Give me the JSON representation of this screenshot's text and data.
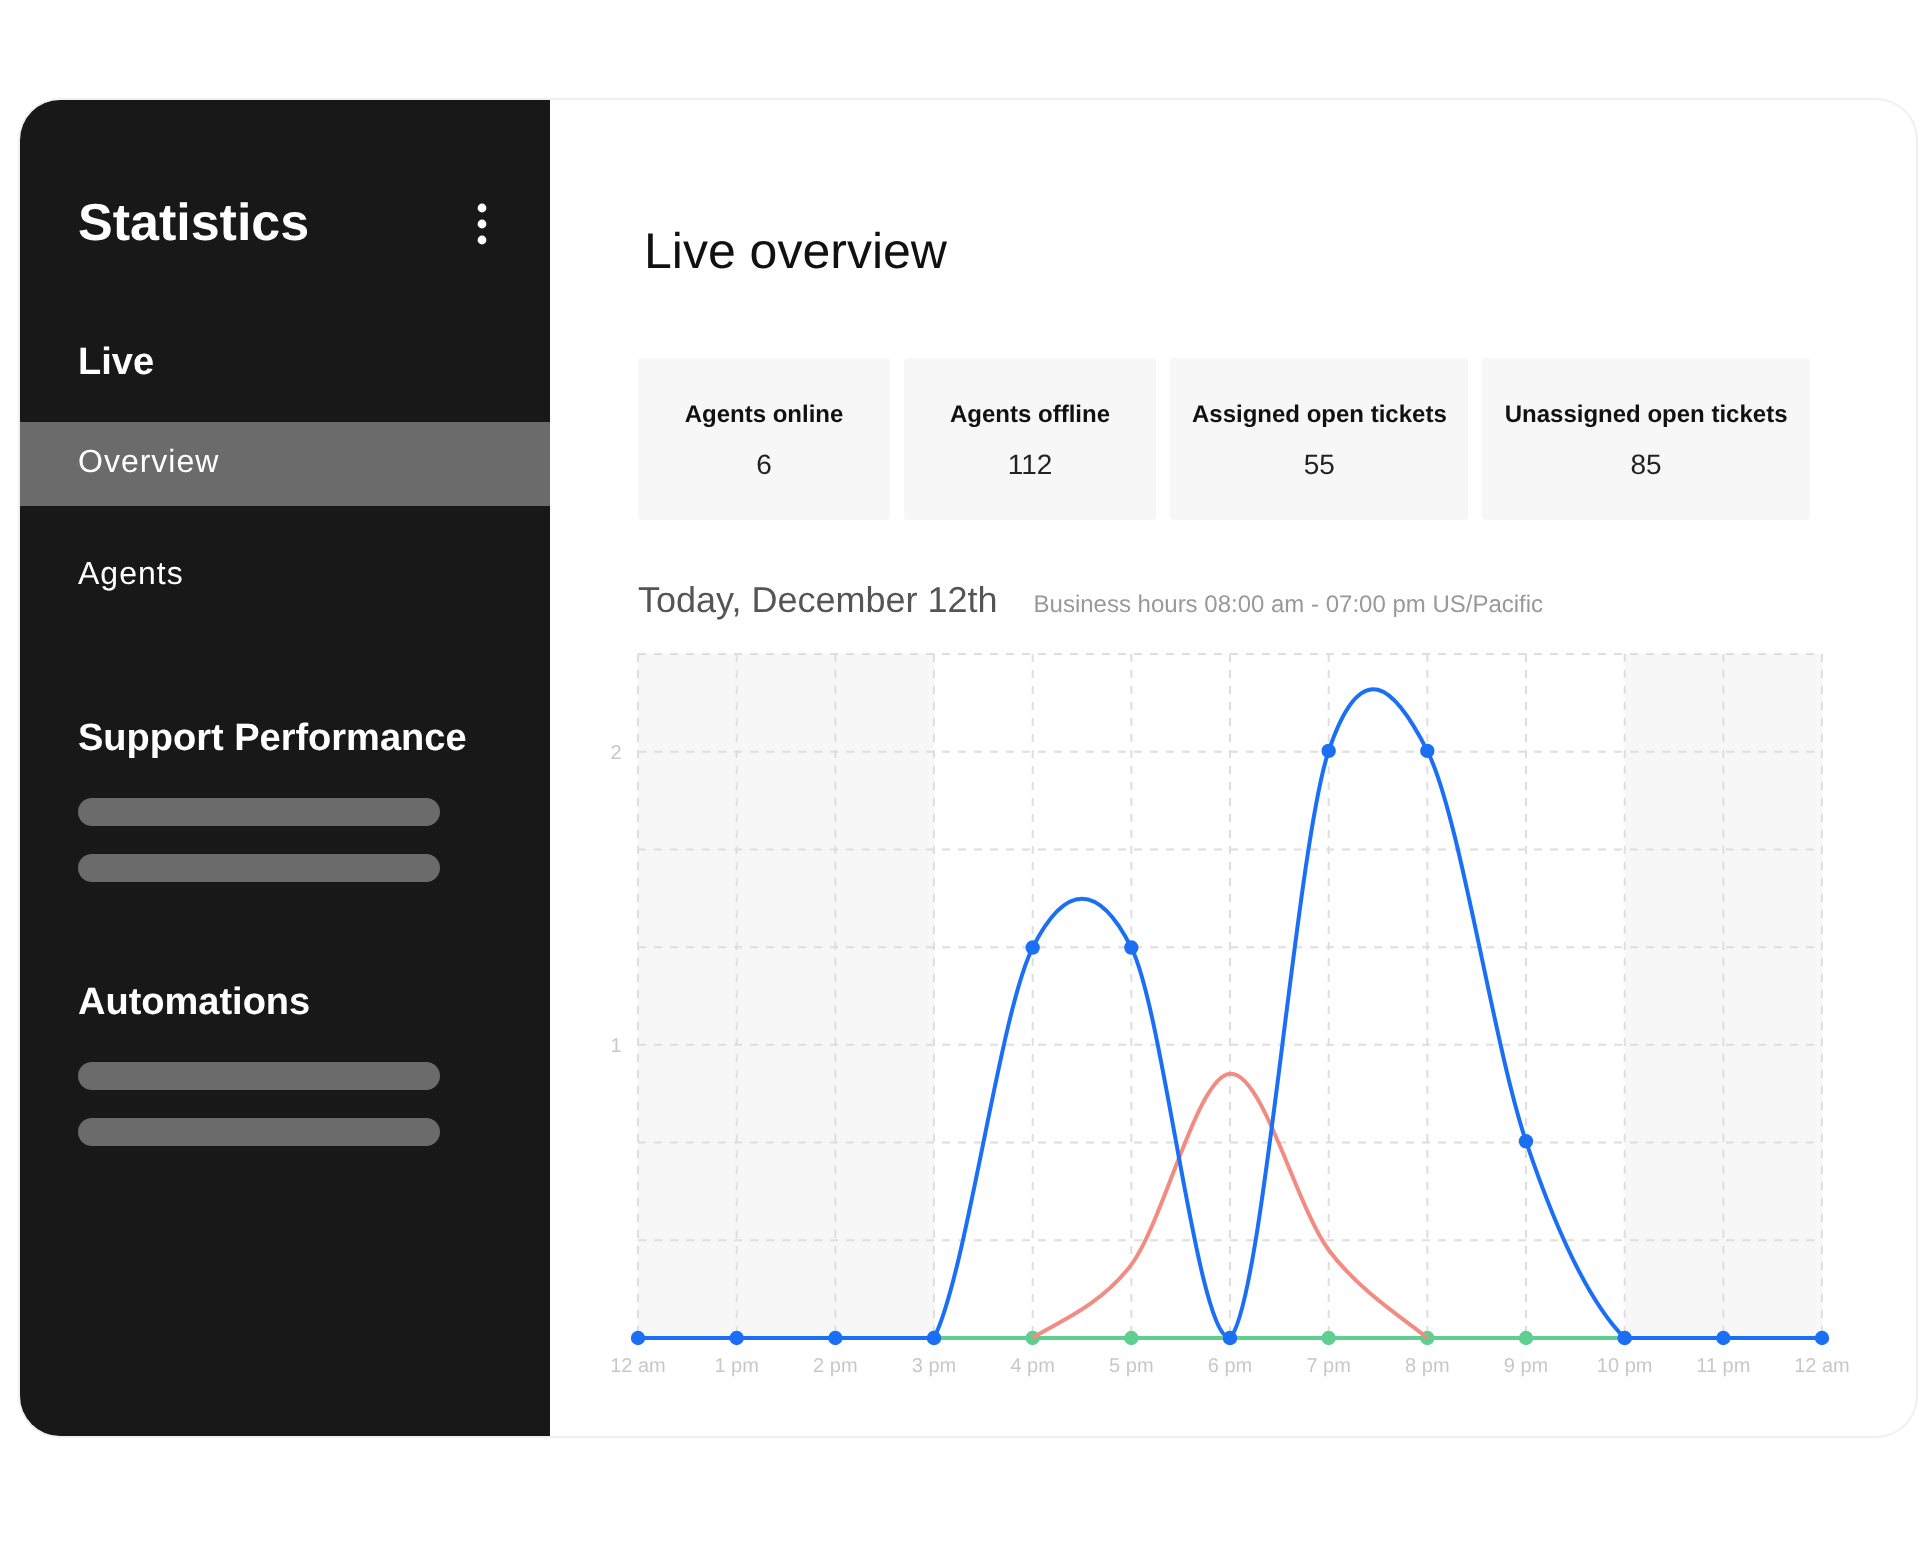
{
  "sidebar": {
    "title": "Statistics",
    "sections": [
      {
        "kind": "nav",
        "title": "Live",
        "items": [
          {
            "label": "Overview",
            "selected": true
          },
          {
            "label": "Agents",
            "selected": false
          }
        ]
      },
      {
        "kind": "placeholder",
        "title": "Support Performance"
      },
      {
        "kind": "placeholder",
        "title": "Automations"
      }
    ]
  },
  "main": {
    "title": "Live overview",
    "stats": [
      {
        "label": "Agents online",
        "value": "6"
      },
      {
        "label": "Agents offline",
        "value": "112"
      },
      {
        "label": "Assigned open tickets",
        "value": "55"
      },
      {
        "label": "Unassigned open tickets",
        "value": "85"
      }
    ],
    "chart": {
      "title": "Today, December 12th",
      "subtitle": "Business hours 08:00 am - 07:00 pm US/Pacific",
      "chart_data": {
        "type": "line",
        "grid": true,
        "categories": [
          "12 am",
          "1 pm",
          "2 pm",
          "3 pm",
          "4 pm",
          "5 pm",
          "6 pm",
          "7 pm",
          "8 pm",
          "9 pm",
          "10 pm",
          "11 pm",
          "12 am"
        ],
        "ylim": [
          0,
          2.33
        ],
        "yticks": [
          1,
          2
        ],
        "series": [
          {
            "color": "#1a6ff5",
            "marker": "circle",
            "values": [
              0,
              0,
              0,
              0,
              1.33,
              1.33,
              0,
              2,
              2,
              0.67,
              0,
              0,
              0
            ]
          },
          {
            "color": "#f28b82",
            "values": [
              null,
              null,
              null,
              null,
              0,
              0.25,
              0.9,
              0.3,
              0,
              null,
              null,
              null,
              null
            ]
          },
          {
            "color": "#5fcf8f",
            "marker": "circle",
            "values": [
              null,
              null,
              null,
              0,
              0,
              0,
              0,
              0,
              0,
              0,
              0,
              null,
              null
            ]
          }
        ]
      }
    }
  }
}
